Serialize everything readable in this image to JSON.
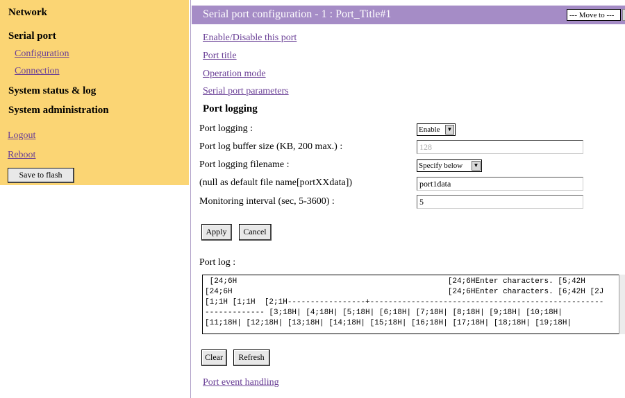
{
  "sidebar": {
    "network": "Network",
    "serial_port": "Serial port",
    "configuration": "Configuration",
    "connection": "Connection",
    "system_status": "System status & log",
    "system_admin": "System administration",
    "logout": "Logout",
    "reboot": "Reboot",
    "save_flash": "Save to flash"
  },
  "header": {
    "title": "Serial port configuration - 1 : Port_Title#1",
    "move_to": "--- Move to ---"
  },
  "links": {
    "enable_disable": "Enable/Disable this port",
    "port_title": "Port title",
    "operation_mode": "Operation mode",
    "serial_params": "Serial port parameters",
    "event_handling": "Port event handling"
  },
  "section_title": "Port logging",
  "form": {
    "logging_label": "Port logging :",
    "logging_value": "Enable",
    "buffer_label": "Port log buffer size (KB, 200 max.) :",
    "buffer_value": "128",
    "filename_label": "Port logging filename :",
    "filename_select": "Specify below",
    "default_label": "(null as default file name[portXXdata])",
    "filename_value": "port1data",
    "interval_label": "Monitoring interval (sec, 5-3600) :",
    "interval_value": "5",
    "apply": "Apply",
    "cancel": "Cancel"
  },
  "log": {
    "label": "Port log :",
    "lines": [
      " [24;6H                                              [24;6HEnter characters. [5;42H",
      "[24;6H                                               [24;6HEnter characters. [6;42H [2J",
      "[1;1H [1;1H  [2;1H-----------------+---------------------------------------------------",
      "------------- [3;18H| [4;18H| [5;18H| [6;18H| [7;18H| [8;18H| [9;18H| [10;18H|",
      "[11;18H| [12;18H| [13;18H| [14;18H| [15;18H| [16;18H| [17;18H| [18;18H| [19;18H|"
    ],
    "clear": "Clear",
    "refresh": "Refresh"
  }
}
